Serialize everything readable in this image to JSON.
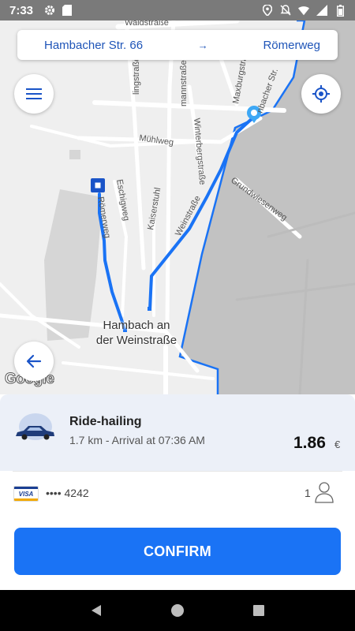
{
  "status_bar": {
    "time": "7:33",
    "icons_left": [
      "gear-icon",
      "sd-card-icon"
    ],
    "icons_right": [
      "location-icon",
      "notifications-off-icon",
      "wifi-icon",
      "signal-icon",
      "battery-icon"
    ]
  },
  "route": {
    "from": "Hambacher Str. 66",
    "arrow": "→",
    "to": "Römerweg"
  },
  "map": {
    "town_label_line1": "Hambach an",
    "town_label_line2": "der Weinstraße",
    "google_logo": "Google",
    "street_labels": {
      "waldstrasse": "Waldstraße",
      "lingstrasse": "lingstraße",
      "mannstrasse": "mannstraße",
      "maxburgstrasse": "Maxburgstraße",
      "hambacher_str": "nbacher Str.",
      "winterbergstrasse": "Winterbergstraße",
      "muhlweg": "Mühlweg",
      "eschigweg": "Eschigweg",
      "romerweg": "Römerweg",
      "kaiserstuhl": "Kaiserstuhl",
      "weinstrasse": "Weinstraße",
      "grundwiesenweg": "Grundwiesenweg"
    },
    "colors": {
      "route": "#1a73f5",
      "area_shade": "#8c8c8c",
      "background": "#efefef"
    }
  },
  "ride": {
    "title": "Ride-hailing",
    "subtitle": "1.7 km - Arrival at 07:36 AM",
    "price": "1.86",
    "currency": "€"
  },
  "payment": {
    "card_brand": "VISA",
    "card_number": "•••• 4242",
    "passengers": "1"
  },
  "actions": {
    "confirm_label": "CONFIRM"
  },
  "nav": {
    "buttons": [
      "back-icon",
      "home-icon",
      "recents-icon"
    ]
  }
}
